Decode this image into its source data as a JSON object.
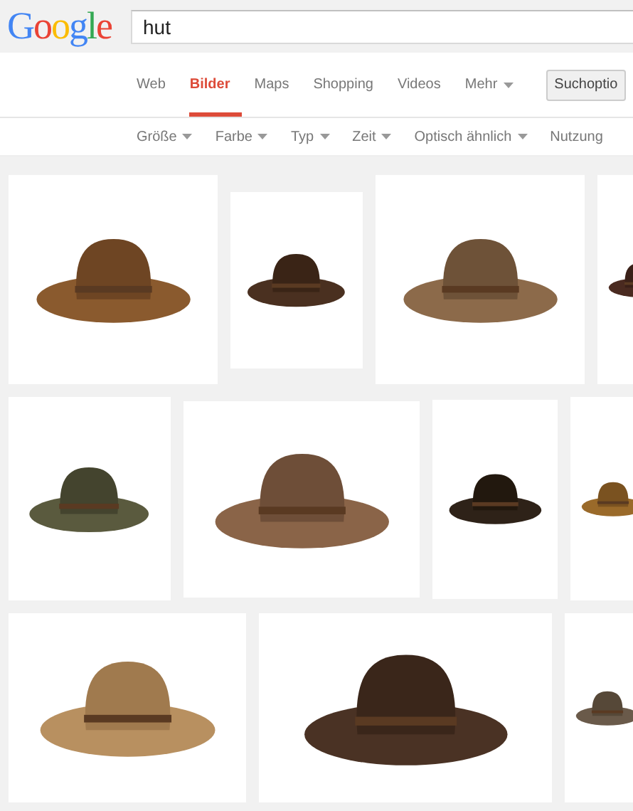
{
  "header": {
    "logo": "Google",
    "search": {
      "value": "hut"
    }
  },
  "tabs": [
    {
      "label": "Web",
      "selected": false
    },
    {
      "label": "Bilder",
      "selected": true
    },
    {
      "label": "Maps",
      "selected": false
    },
    {
      "label": "Shopping",
      "selected": false
    },
    {
      "label": "Videos",
      "selected": false
    },
    {
      "label": "Mehr",
      "selected": false,
      "kind": "menu"
    }
  ],
  "search_options_button": "Suchoptio",
  "filters": [
    {
      "label": "Größe",
      "kind": "menu"
    },
    {
      "label": "Farbe",
      "kind": "menu"
    },
    {
      "label": "Typ",
      "kind": "menu"
    },
    {
      "label": "Zeit",
      "kind": "menu"
    },
    {
      "label": "Optisch ähnlich",
      "kind": "menu"
    },
    {
      "label": "Nutzung",
      "kind": "plain"
    }
  ],
  "results": [
    {
      "images": [
        {
          "kind": "photo"
        },
        {
          "kind": "photo"
        },
        {
          "kind": "photo"
        },
        {
          "kind": "photo"
        }
      ]
    },
    {
      "images": [
        {
          "kind": "photo"
        },
        {
          "kind": "photo"
        },
        {
          "kind": "photo"
        },
        {
          "kind": "photo"
        }
      ]
    },
    {
      "images": [
        {
          "kind": "photo"
        },
        {
          "kind": "photo"
        },
        {
          "kind": "photo"
        }
      ]
    }
  ]
}
